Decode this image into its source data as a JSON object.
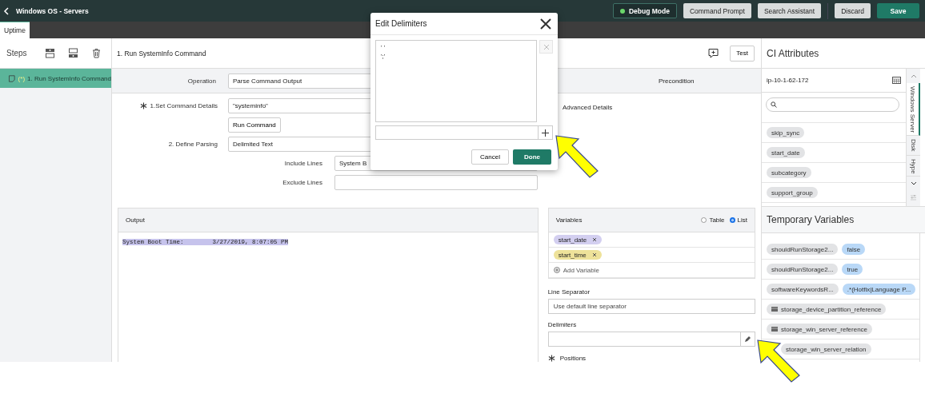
{
  "top_bar": {
    "title": "Windows OS - Servers",
    "debug": {
      "label": "Debug Mode",
      "on": true
    },
    "buttons": [
      {
        "label": "Command Prompt",
        "kind": "plain"
      },
      {
        "label": "Search Assistant",
        "kind": "plain"
      },
      {
        "label": "Discard",
        "kind": "plain"
      },
      {
        "label": "Save",
        "kind": "primary"
      }
    ]
  },
  "tabs": [
    {
      "label": "Uptime",
      "selected": true
    }
  ],
  "steps": {
    "title": "Steps",
    "items": [
      {
        "marker": "(*)",
        "label": "1.  Run SystemInfo Command",
        "selected": true
      }
    ]
  },
  "step": {
    "title": "1. Run SystemInfo Command",
    "test_button": "Test",
    "operation": {
      "label": "Operation",
      "value": "Parse Command Output"
    },
    "precondition": "Precondition",
    "command": {
      "label": "1.Set Command Details",
      "required": true,
      "value": "\"systeminfo\"",
      "run_button": "Run Command"
    },
    "parsing": {
      "label": "2. Define Parsing",
      "value": "Delimited Text"
    },
    "include_lines": {
      "label": "Include Lines",
      "value": "System B"
    },
    "exclude_lines": {
      "label": "Exclude Lines"
    },
    "advanced": "Advanced Details"
  },
  "output": {
    "title": "Output",
    "lines": [
      "System Boot Time:        3/27/2019, 8:07:05 PM"
    ]
  },
  "variables": {
    "title": "Variables",
    "views": [
      {
        "label": "Table",
        "selected": false
      },
      {
        "label": "List",
        "selected": true
      }
    ],
    "items": [
      {
        "name": "start_date",
        "color": "#d3cff0"
      },
      {
        "name": "start_time",
        "color": "#eee29a"
      }
    ],
    "add": "Add Variable"
  },
  "line_separator": {
    "label": "Line Separator",
    "placeholder": "Use default line separator"
  },
  "delimiters": {
    "label": "Delimiters"
  },
  "positions": {
    "label": "Positions",
    "required": true
  },
  "ci_attributes": {
    "title": "CI Attributes",
    "ci": "ip-10-1-62-172",
    "items": [
      "skip_sync",
      "start_date",
      "subcategory",
      "support_group"
    ],
    "side_tabs": [
      {
        "label": "Windows Server",
        "selected": true
      },
      {
        "label": "Disk",
        "selected": false
      },
      {
        "label": "Hype",
        "selected": false
      }
    ]
  },
  "temporary_variables": {
    "title": "Temporary Variables",
    "items": [
      {
        "name": "shouldRunStorage2...",
        "value": "false",
        "kind": "value"
      },
      {
        "name": "shouldRunStorage2...",
        "value": "true",
        "kind": "value"
      },
      {
        "name": "softwareKeywordsR...",
        "value": ".*(Hotfix|Language P...",
        "kind": "value"
      },
      {
        "name": "storage_device_partition_reference",
        "kind": "reference"
      },
      {
        "name": "storage_win_server_reference",
        "kind": "reference"
      },
      {
        "name": "storage_win_server_relation",
        "kind": "plain"
      }
    ]
  },
  "dialog": {
    "title": "Edit Delimiters",
    "delimiters": [
      "' '",
      "';'"
    ],
    "cancel": "Cancel",
    "done": "Done"
  }
}
